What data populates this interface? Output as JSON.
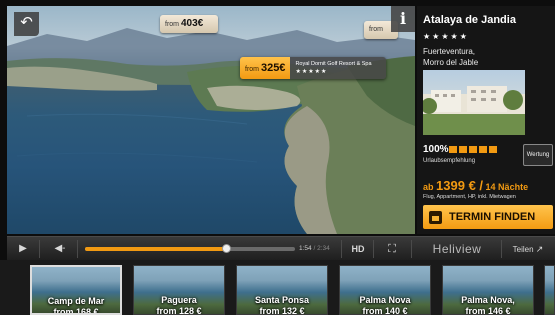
{
  "video": {
    "back_icon": "back-arrow-icon",
    "info_label": "i",
    "price_tags": [
      {
        "prefix": "from",
        "price": "403€"
      },
      {
        "prefix": "from",
        "price": ""
      }
    ],
    "featured_hotel": {
      "prefix": "from",
      "price": "325€",
      "name": "Royal Dornit Golf Resort & Spa",
      "stars": "★★★★★"
    }
  },
  "panel": {
    "hotel_name": "Atalaya de Jandia",
    "stars": "★★★★★",
    "location_line1": "Fuerteventura,",
    "location_line2": "Morro del Jable",
    "rating_percent": "100%",
    "rating_bars_filled": 5,
    "recommendation_label": "Urlaubsempfehlung",
    "rating_button": "Wertung",
    "price_prefix": "ab",
    "price_amount": "1399 € /",
    "price_duration": "14 Nächte",
    "price_details": "Flug, Appartment, HP, inkl. Mietwagen",
    "cta_label": "TERMIN FINDEN"
  },
  "controls": {
    "play_icon": "play-icon",
    "volume_icon": "volume-icon",
    "progress": 0.67,
    "time_current": "1:54",
    "time_separator": "/",
    "time_total": "2:34",
    "hd_label": "HD",
    "fullscreen_icon": "fullscreen-icon",
    "brand_label": "Heliview",
    "share_label": "Teilen",
    "share_icon": "share-icon"
  },
  "thumbnails": [
    {
      "name": "Camp de Mar",
      "price": "from 168 €"
    },
    {
      "name": "Paguera",
      "price": "from 128 €"
    },
    {
      "name": "Santa Ponsa",
      "price": "from 132 €"
    },
    {
      "name": "Palma Nova",
      "price": "from 140 €"
    },
    {
      "name": "Palma Nova,",
      "price": "from 146 €"
    }
  ],
  "colors": {
    "accent": "#f29a12",
    "panel_bg": "#151515"
  }
}
